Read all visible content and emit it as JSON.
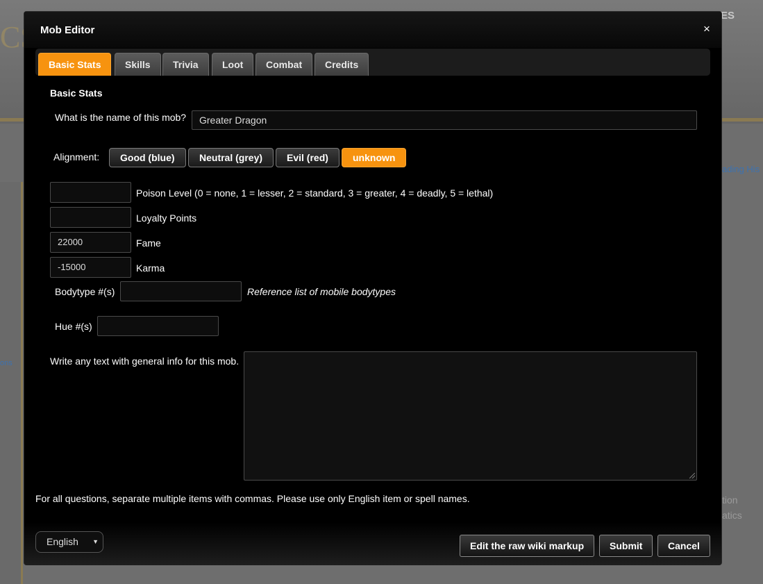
{
  "background": {
    "logo_fragment": "CS",
    "top_right_fragment": "ES",
    "links_fragment": "ading  His",
    "side_text_1": "tion",
    "side_text_2": "atics",
    "left_text": "ons"
  },
  "dialog": {
    "title": "Mob Editor",
    "close_label": "×"
  },
  "tabs": [
    {
      "label": "Basic Stats",
      "active": true
    },
    {
      "label": "Skills",
      "active": false
    },
    {
      "label": "Trivia",
      "active": false
    },
    {
      "label": "Loot",
      "active": false
    },
    {
      "label": "Combat",
      "active": false
    },
    {
      "label": "Credits",
      "active": false
    }
  ],
  "section_title": "Basic Stats",
  "name_question": "What is the name of this mob?",
  "name_value": "Greater Dragon",
  "alignment": {
    "label": "Alignment:",
    "options": [
      "Good (blue)",
      "Neutral (grey)",
      "Evil (red)",
      "unknown"
    ],
    "selected": "unknown"
  },
  "fields": {
    "poison_label": "Poison Level (0 = none, 1 = lesser, 2 = standard, 3 = greater, 4 = deadly, 5 = lethal)",
    "poison_value": "",
    "loyalty_label": "Loyalty Points",
    "loyalty_value": "",
    "fame_label": "Fame",
    "fame_value": "22000",
    "karma_label": "Karma",
    "karma_value": "-15000",
    "bodytype_label": "Bodytype #(s)",
    "bodytype_value": "",
    "bodytype_reference": "Reference list of mobile bodytypes",
    "hue_label": "Hue #(s)",
    "hue_value": ""
  },
  "general_info_label": "Write any text with general info for this mob.",
  "general_info_value": "",
  "note": "For all questions, separate multiple items with commas. Please use only English item or spell names.",
  "footer": {
    "language": "English",
    "edit_raw_label": "Edit the raw wiki markup",
    "submit_label": "Submit",
    "cancel_label": "Cancel"
  }
}
